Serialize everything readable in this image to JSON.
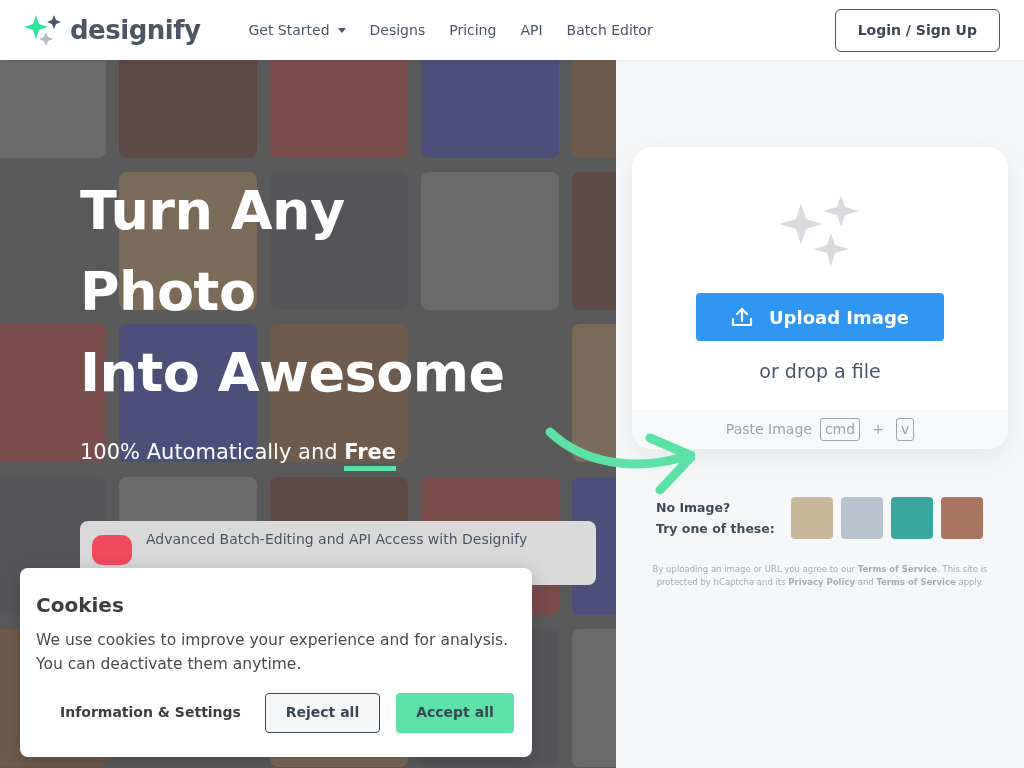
{
  "navbar": {
    "logo": "designify",
    "links": [
      {
        "label": "Get Started",
        "dropdown": true
      },
      {
        "label": "Designs",
        "dropdown": false
      },
      {
        "label": "Pricing",
        "dropdown": false
      },
      {
        "label": "API",
        "dropdown": false
      },
      {
        "label": "Batch Editor",
        "dropdown": false
      }
    ],
    "login": "Login / Sign Up"
  },
  "hero": {
    "title_lines": [
      "Turn Any",
      "Photo",
      "Into Awesome"
    ],
    "subtitle": "100% Automatically and",
    "subtitle_highlight": "Free",
    "banner": "Advanced Batch-Editing and API Access with Designify"
  },
  "upload": {
    "button": "Upload Image",
    "drop_text": "or drop a file",
    "paste_label": "Paste Image",
    "keys": [
      "cmd",
      "v"
    ],
    "plus": "+"
  },
  "samples": {
    "label_lines": [
      "No Image?",
      "Try one of these:"
    ]
  },
  "legal": "By uploading an image or URL you agree to our **Terms of Service**. This site is protected by hCaptcha and its **Privacy Policy** and **Terms of Service** apply.",
  "cookies": {
    "title": "Cookies",
    "text": "We use cookies to improve your experience and for analysis. You can deactivate them anytime.",
    "buttons": [
      {
        "label": "Information & Settings",
        "kind": "link"
      },
      {
        "label": "Reject all",
        "kind": "outline"
      },
      {
        "label": "Accept all",
        "kind": "primary"
      }
    ]
  }
}
